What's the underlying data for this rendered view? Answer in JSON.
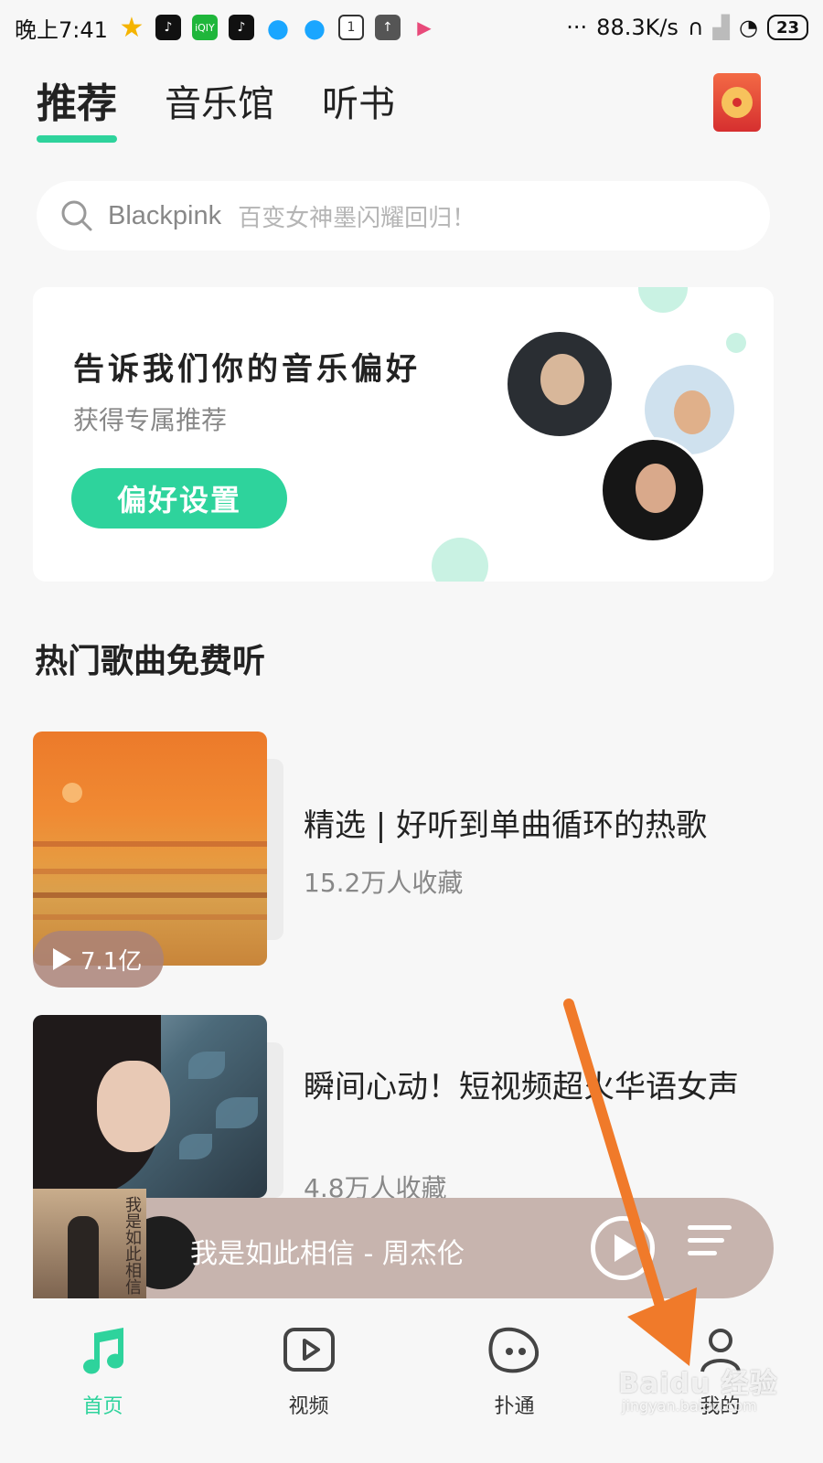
{
  "status_bar": {
    "time": "晚上7:41",
    "network_speed": "88.3K/s",
    "battery": "23",
    "dots": "···"
  },
  "top_tabs": [
    {
      "label": "推荐",
      "active": true
    },
    {
      "label": "音乐馆",
      "active": false
    },
    {
      "label": "听书",
      "active": false
    }
  ],
  "search": {
    "keyword": "Blackpink",
    "hint": "百变女神墨闪耀回归！"
  },
  "pref_card": {
    "title": "告诉我们你的音乐偏好",
    "subtitle": "获得专属推荐",
    "button_label": "偏好设置"
  },
  "section": {
    "title": "热门歌曲免费听"
  },
  "playlists": [
    {
      "title": "精选 | 好听到单曲循环的热歌",
      "favorites": "15.2万人收藏",
      "play_count": "7.1亿"
    },
    {
      "title": "瞬间心动！短视频超火华语女声",
      "favorites": "4.8万人收藏"
    }
  ],
  "mini_player": {
    "now_playing": "我是如此相信 - 周杰伦",
    "cover_text": "我是如此相信"
  },
  "bottom_nav": [
    {
      "label": "首页",
      "active": true,
      "icon": "music-note-icon"
    },
    {
      "label": "视频",
      "active": false,
      "icon": "video-play-icon"
    },
    {
      "label": "扑通",
      "active": false,
      "icon": "social-face-icon"
    },
    {
      "label": "我的",
      "active": false,
      "icon": "profile-icon"
    }
  ],
  "watermark": {
    "text": "Baidu 经验",
    "sub": "jingyan.baidu.com"
  },
  "colors": {
    "accent": "#2ed39c",
    "annotation_arrow": "#f07a2a",
    "mini_player_bg": "#c4b0aa"
  }
}
